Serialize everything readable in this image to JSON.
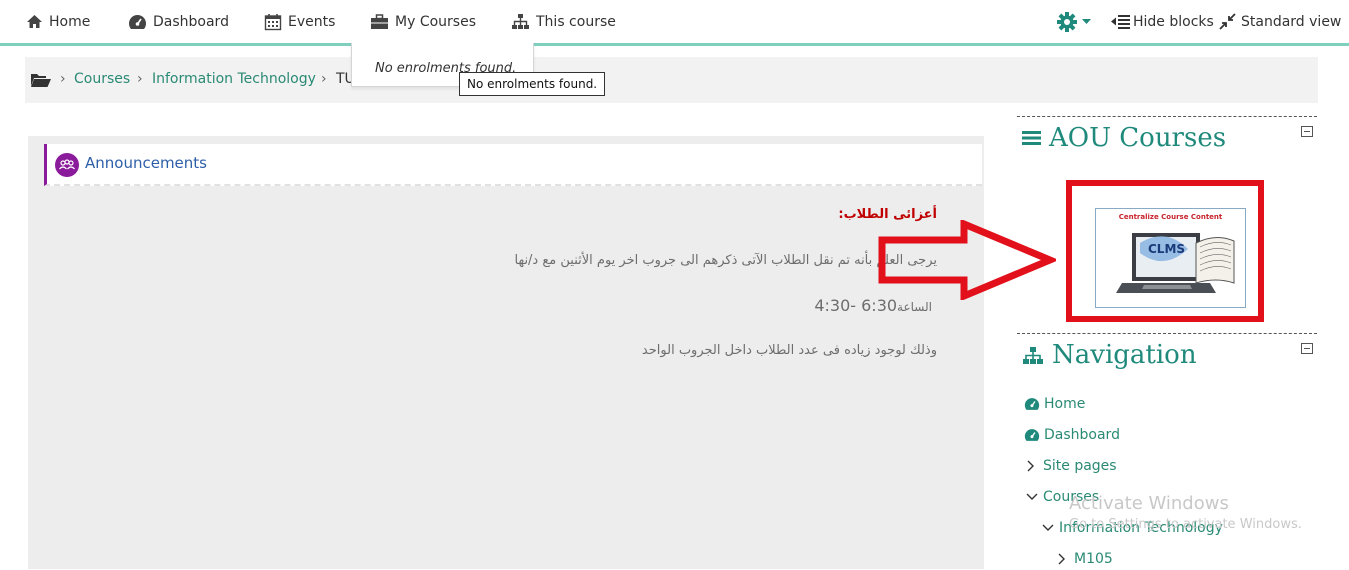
{
  "navbar": {
    "home": "Home",
    "dashboard": "Dashboard",
    "events": "Events",
    "my_courses": "My Courses",
    "this_course": "This course",
    "hide_blocks": "Hide blocks",
    "standard_view": "Standard view"
  },
  "dropdown": {
    "message": "No enrolments found.",
    "tooltip": "No enrolments found."
  },
  "breadcrumb": {
    "items": [
      "Courses",
      "Information Technology",
      "TU"
    ]
  },
  "announcement": {
    "title": "Announcements",
    "greeting": "أعزائى الطلاب:",
    "line1": "يرجى العلم بأنه تم نقل الطلاب الآتى ذكرهم الى جروب اخر يوم الأثنين مع د/نها",
    "time_label": "الساعة",
    "time_value": "4:30- 6:30",
    "line3": "وذلك لوجود زياده فى عدد الطلاب داخل الجروب الواحد"
  },
  "aou_block": {
    "title": "AOU Courses",
    "logo_caption": "Centralize Course Content",
    "logo_text": "CLMS"
  },
  "navigation_block": {
    "title": "Navigation",
    "items": [
      "Home",
      "Dashboard",
      "Site pages",
      "Courses",
      "Information Technology",
      "M105"
    ]
  },
  "watermark": {
    "title": "Activate Windows",
    "subtitle": "Go to Settings to activate Windows."
  },
  "colors": {
    "accent": "#1f8a7c",
    "link": "#2a8a74",
    "navbar_border": "#7fcfbf",
    "announcement_title": "#2d5fa8",
    "forum_icon": "#8a1b9a",
    "highlight_red": "#e2101a"
  }
}
